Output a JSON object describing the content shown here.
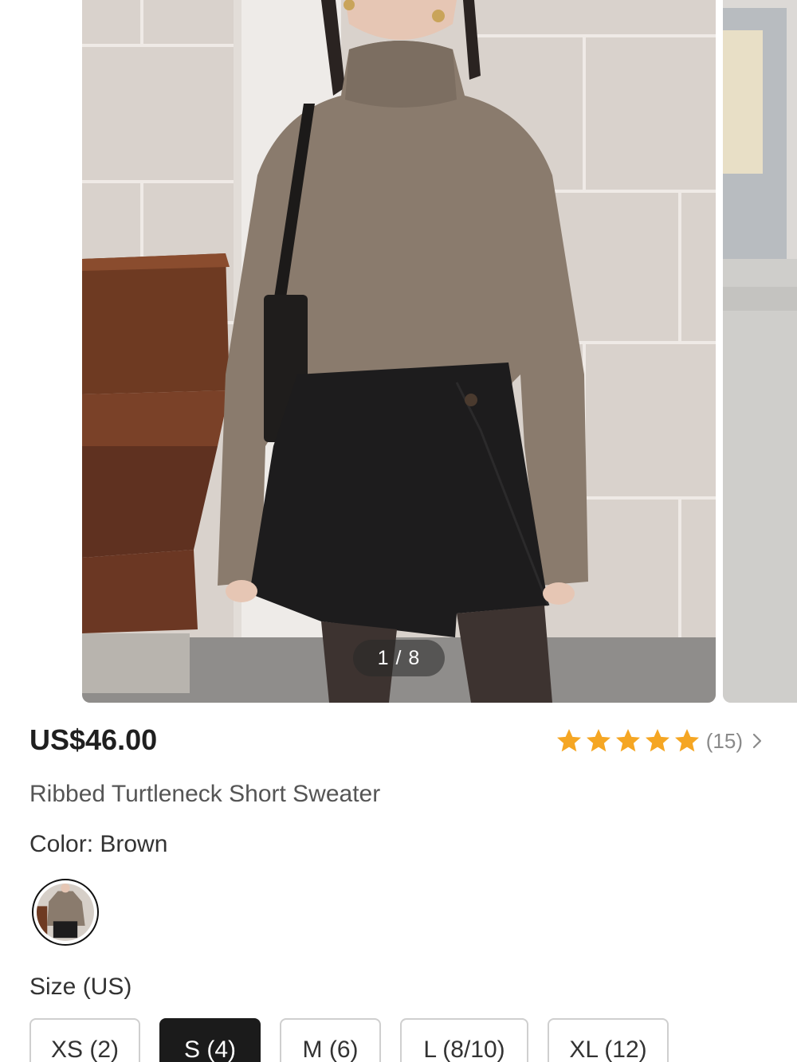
{
  "gallery": {
    "counter": "1 / 8",
    "current_image": 1,
    "total_images": 8
  },
  "product": {
    "price": "US$46.00",
    "rating": {
      "stars": 5,
      "max_stars": 5,
      "count": "(15)",
      "star_color": "#F5A623"
    },
    "title": "Ribbed Turtleneck Short Sweater",
    "color": {
      "label": "Color:",
      "value": "Brown"
    },
    "size": {
      "label": "Size (US)",
      "options": [
        "XS (2)",
        "S (4)",
        "M (6)",
        "L (8/10)",
        "XL (12)"
      ],
      "selected": "S (4)"
    }
  },
  "colors": {
    "accent": "#1B1B1B",
    "star": "#F5A623",
    "muted_text": "#8A8A8A"
  }
}
